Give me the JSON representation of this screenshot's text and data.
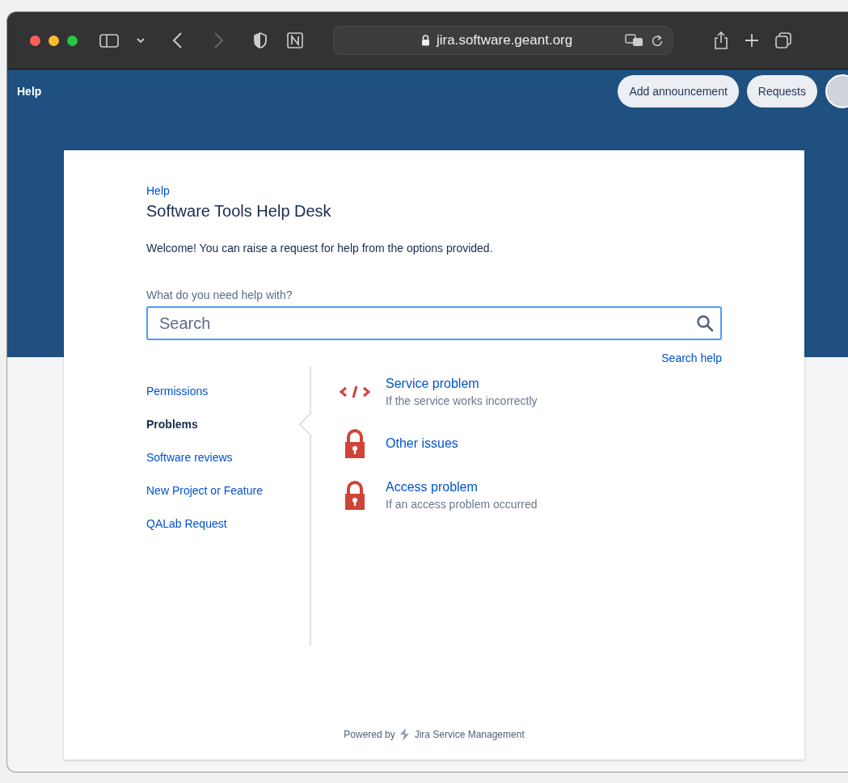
{
  "browser": {
    "address": "jira.software.geant.org"
  },
  "header": {
    "title": "Help",
    "buttons": [
      "Add announcement",
      "Requests"
    ]
  },
  "portal": {
    "breadcrumb": "Help",
    "title": "Software Tools Help Desk",
    "welcome": "Welcome! You can raise a request for help from the options provided.",
    "search_label": "What do you need help with?",
    "search": {
      "placeholder": "Search"
    },
    "search_help": "Search help"
  },
  "groups": [
    {
      "label": "Permissions",
      "selected": false
    },
    {
      "label": "Problems",
      "selected": true
    },
    {
      "label": "Software reviews",
      "selected": false
    },
    {
      "label": "New Project or Feature",
      "selected": false
    },
    {
      "label": "QALab Request",
      "selected": false
    }
  ],
  "request_types": [
    {
      "kind": "code",
      "title": "Service problem",
      "description": "If the service works incorrectly"
    },
    {
      "kind": "lock",
      "title": "Other issues"
    },
    {
      "kind": "lock",
      "title": "Access problem",
      "description": "If an access problem occurred"
    }
  ],
  "footer": {
    "prefix": "Powered by",
    "product": "Jira Service Management"
  }
}
